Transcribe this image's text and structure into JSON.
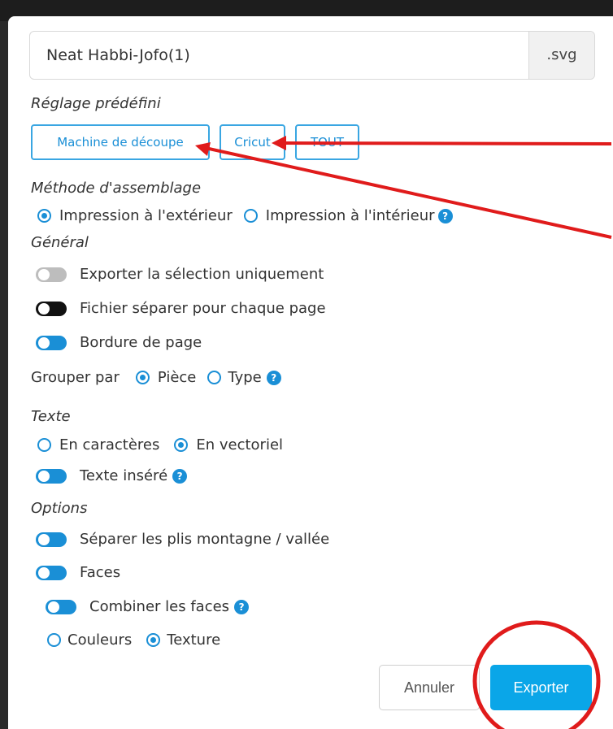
{
  "filename": {
    "value": "Neat Habbi-Jofo(1)",
    "extension": ".svg"
  },
  "presets": {
    "heading": "Réglage prédéfini",
    "buttons": [
      "Machine de découpe",
      "Cricut",
      "TOUT"
    ]
  },
  "assembly": {
    "heading": "Méthode d'assemblage",
    "options": [
      {
        "label": "Impression à l'extérieur",
        "selected": true
      },
      {
        "label": "Impression à l'intérieur",
        "selected": false
      }
    ],
    "help_icon": "?"
  },
  "general": {
    "heading": "Général",
    "toggles": [
      {
        "label": "Exporter la sélection uniquement",
        "state": "off"
      },
      {
        "label": "Fichier séparer pour chaque page",
        "state": "dark"
      },
      {
        "label": "Bordure de page",
        "state": "on"
      }
    ],
    "group_by": {
      "label": "Grouper par",
      "options": [
        {
          "label": "Pièce",
          "selected": true
        },
        {
          "label": "Type",
          "selected": false
        }
      ],
      "help_icon": "?"
    }
  },
  "text": {
    "heading": "Texte",
    "options": [
      {
        "label": "En caractères",
        "selected": false
      },
      {
        "label": "En vectoriel",
        "selected": true
      }
    ],
    "inserted": {
      "label": "Texte inséré",
      "state": "on",
      "help_icon": "?"
    }
  },
  "options": {
    "heading": "Options",
    "toggles": [
      {
        "label": "Séparer les plis montagne / vallée",
        "state": "on"
      },
      {
        "label": "Faces",
        "state": "on"
      }
    ],
    "combine": {
      "label": "Combiner les faces",
      "state": "on",
      "help_icon": "?"
    },
    "face_mode": [
      {
        "label": "Couleurs",
        "selected": false
      },
      {
        "label": "Texture",
        "selected": true
      }
    ]
  },
  "actions": {
    "cancel": "Annuler",
    "export": "Exporter"
  },
  "colors": {
    "accent": "#1a8fd6",
    "export_button": "#0aa6e8",
    "annotation_red": "#e01b1b"
  },
  "icons": [
    "help-icon",
    "radio-icon",
    "toggle-icon"
  ]
}
